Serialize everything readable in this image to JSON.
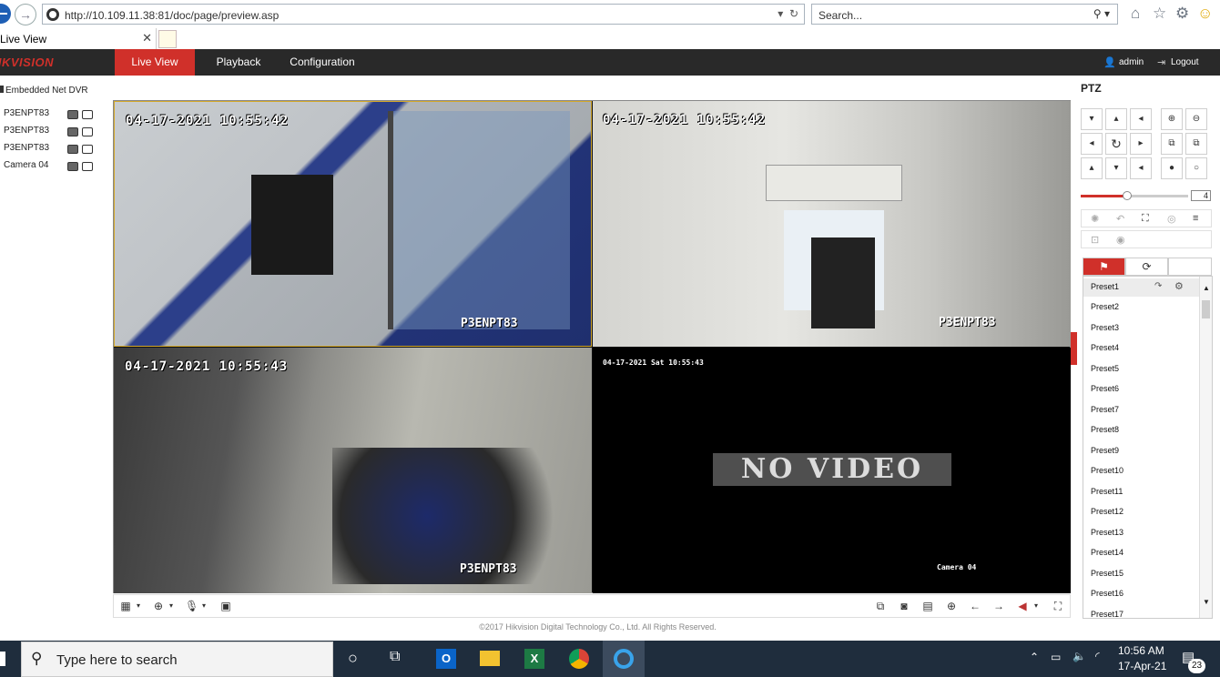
{
  "browser": {
    "url": "http://10.109.11.38:81/doc/page/preview.asp",
    "search_placeholder": "Search...",
    "tab_title": "Live View"
  },
  "app": {
    "logo": "HIKVISION",
    "menu": [
      "Live View",
      "Playback",
      "Configuration"
    ],
    "user": "admin",
    "logout": "Logout"
  },
  "tree": {
    "root": "Embedded Net DVR",
    "cameras": [
      "P3ENPT83",
      "P3ENPT83",
      "P3ENPT83",
      "Camera 04"
    ]
  },
  "cells": [
    {
      "timestamp": "04-17-2021  10:55:42",
      "label": "P3ENPT83"
    },
    {
      "timestamp": "04-17-2021  10:55:42",
      "label": "P3ENPT83"
    },
    {
      "timestamp": "04-17-2021  10:55:43",
      "label": "P3ENPT83"
    },
    {
      "timestamp": "04-17-2021 Sat 10:55:43",
      "label": "Camera 04",
      "no_video": "NO VIDEO"
    }
  ],
  "copyright": "©2017 Hikvision Digital Technology Co., Ltd. All Rights Reserved.",
  "ptz": {
    "title": "PTZ",
    "speed": "4",
    "speed_level": 0.43,
    "presets": [
      "Preset1",
      "Preset2",
      "Preset3",
      "Preset4",
      "Preset5",
      "Preset6",
      "Preset7",
      "Preset8",
      "Preset9",
      "Preset10",
      "Preset11",
      "Preset12",
      "Preset13",
      "Preset14",
      "Preset15",
      "Preset16",
      "Preset17"
    ]
  },
  "taskbar": {
    "search_placeholder": "Type here to search",
    "time": "10:56 AM",
    "date": "17-Apr-21",
    "notifications": "23"
  },
  "colors": {
    "accent": "#d0302a",
    "header": "#292929"
  }
}
